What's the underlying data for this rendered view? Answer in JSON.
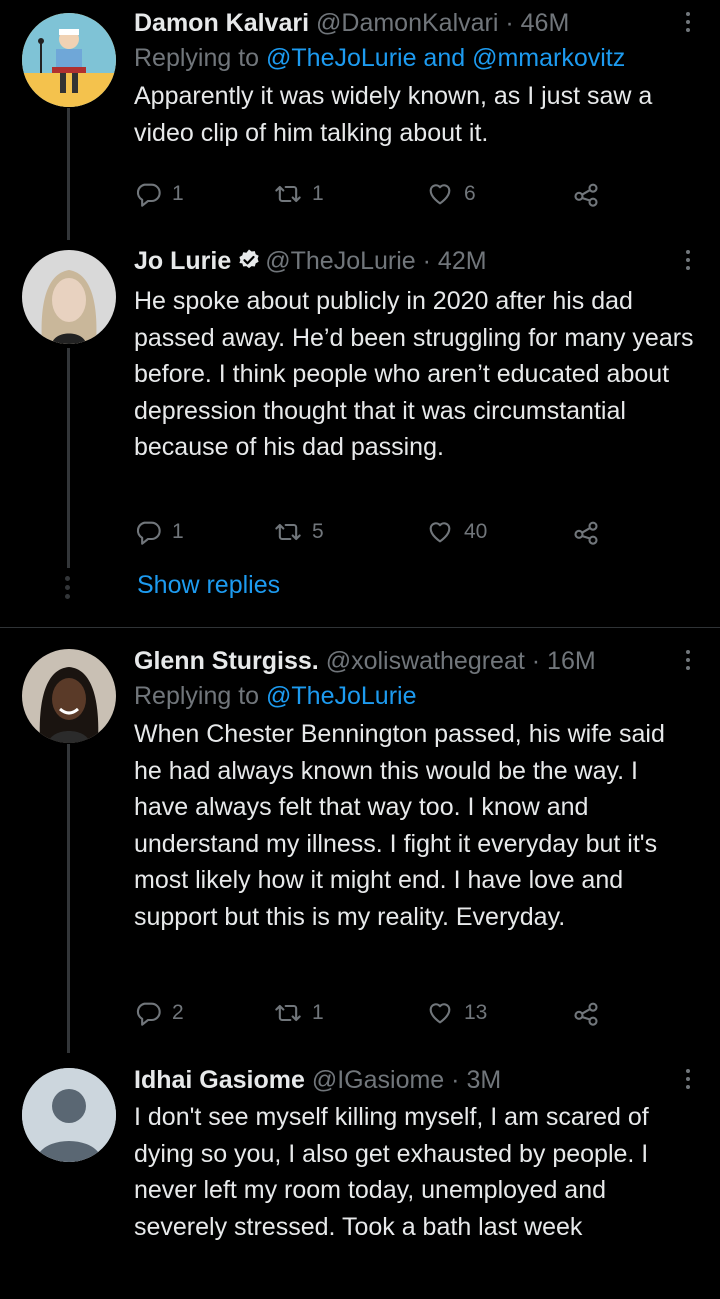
{
  "tweets": [
    {
      "name": "Damon Kalvari",
      "handle": "@DamonKalvari",
      "time": "· 46M",
      "replying_prefix": "Replying to ",
      "replying_to": "@TheJoLurie and @mmarkovitz",
      "text": "Apparently it was widely known, as I just saw a video clip of him talking about it.",
      "replies": "1",
      "retweets": "1",
      "likes": "6",
      "avatar_icon": "cartoon-man-avatar"
    },
    {
      "name": "Jo Lurie",
      "handle": "@TheJoLurie",
      "time": "· 42M",
      "verified": true,
      "text": "He spoke about publicly in 2020 after his dad passed away. He’d been struggling for many years before. I think people who aren’t educated about depression thought that it was circumstantial because of his dad passing.",
      "replies": "1",
      "retweets": "5",
      "likes": "40",
      "avatar_icon": "woman-photo-avatar"
    },
    {
      "name": "Glenn Sturgiss.",
      "handle": "@xoliswathegreat",
      "time": "· 16M",
      "replying_prefix": "Replying to ",
      "replying_to": "@TheJoLurie",
      "text": "When Chester Bennington passed, his wife said he had always known this would be the way. I have always felt that way too. I know and understand my illness. I fight it everyday but it's most likely how it might end. I have love and support but this is my reality. Everyday.",
      "replies": "2",
      "retweets": "1",
      "likes": "13",
      "avatar_icon": "woman-braids-avatar"
    },
    {
      "name": "Idhai Gasiome",
      "handle": "@IGasiome",
      "time": "· 3M",
      "text": "I don't see myself killing myself, I am scared of dying so you, I also get exhausted by people. I never left my room today, unemployed and severely stressed. Took a bath last week",
      "avatar_icon": "default-profile-avatar"
    }
  ],
  "show_replies": "Show replies",
  "colors": {
    "background": "#000000",
    "text": "#e7e9ea",
    "muted": "#71767b",
    "link": "#1d9bf0",
    "line": "#333639"
  }
}
